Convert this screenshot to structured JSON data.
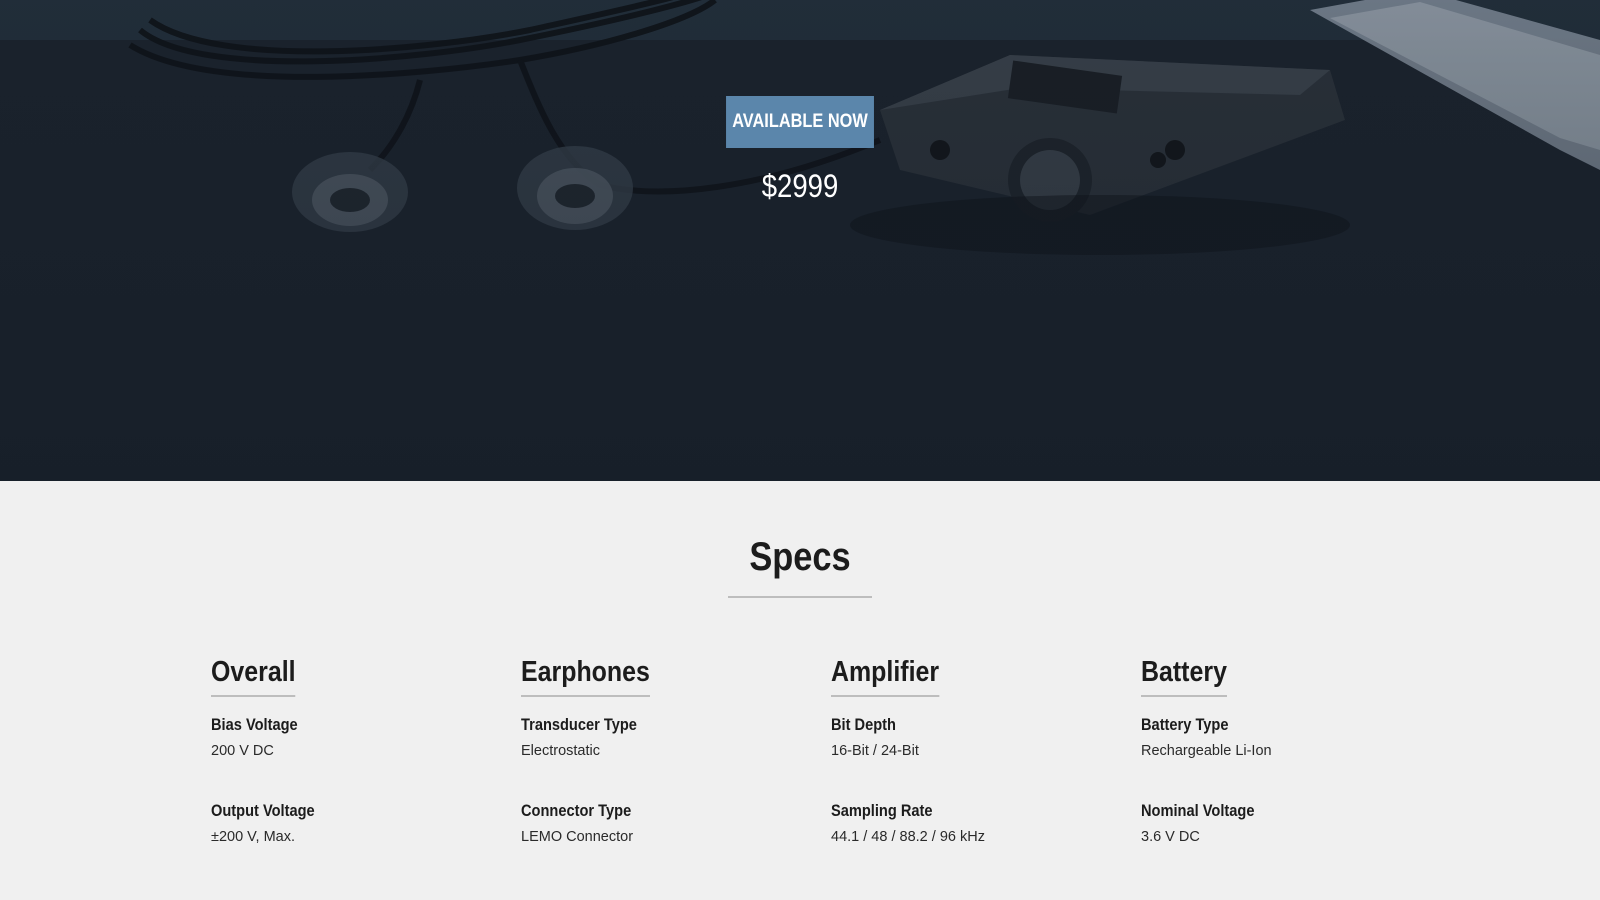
{
  "hero": {
    "cta_label": "AVAILABLE NOW",
    "price": "$2999"
  },
  "specs": {
    "title": "Specs",
    "columns": [
      {
        "heading": "Overall",
        "items": [
          {
            "label": "Bias Voltage",
            "value": "200 V DC"
          },
          {
            "label": "Output Voltage",
            "value": "±200 V, Max."
          }
        ]
      },
      {
        "heading": "Earphones",
        "items": [
          {
            "label": "Transducer Type",
            "value": "Electrostatic"
          },
          {
            "label": "Connector Type",
            "value": "LEMO Connector"
          }
        ]
      },
      {
        "heading": "Amplifier",
        "items": [
          {
            "label": "Bit Depth",
            "value": "16-Bit / 24-Bit"
          },
          {
            "label": "Sampling Rate",
            "value": "44.1 / 48 / 88.2 / 96 kHz"
          }
        ]
      },
      {
        "heading": "Battery",
        "items": [
          {
            "label": "Battery Type",
            "value": "Rechargeable Li-Ion"
          },
          {
            "label": "Nominal Voltage",
            "value": "3.6 V DC"
          }
        ]
      }
    ]
  },
  "colors": {
    "cta_background": "#5b86ab",
    "hero_background": "#1e2732",
    "page_background": "#f0f0f0",
    "text_dark": "#1c1c1c"
  }
}
